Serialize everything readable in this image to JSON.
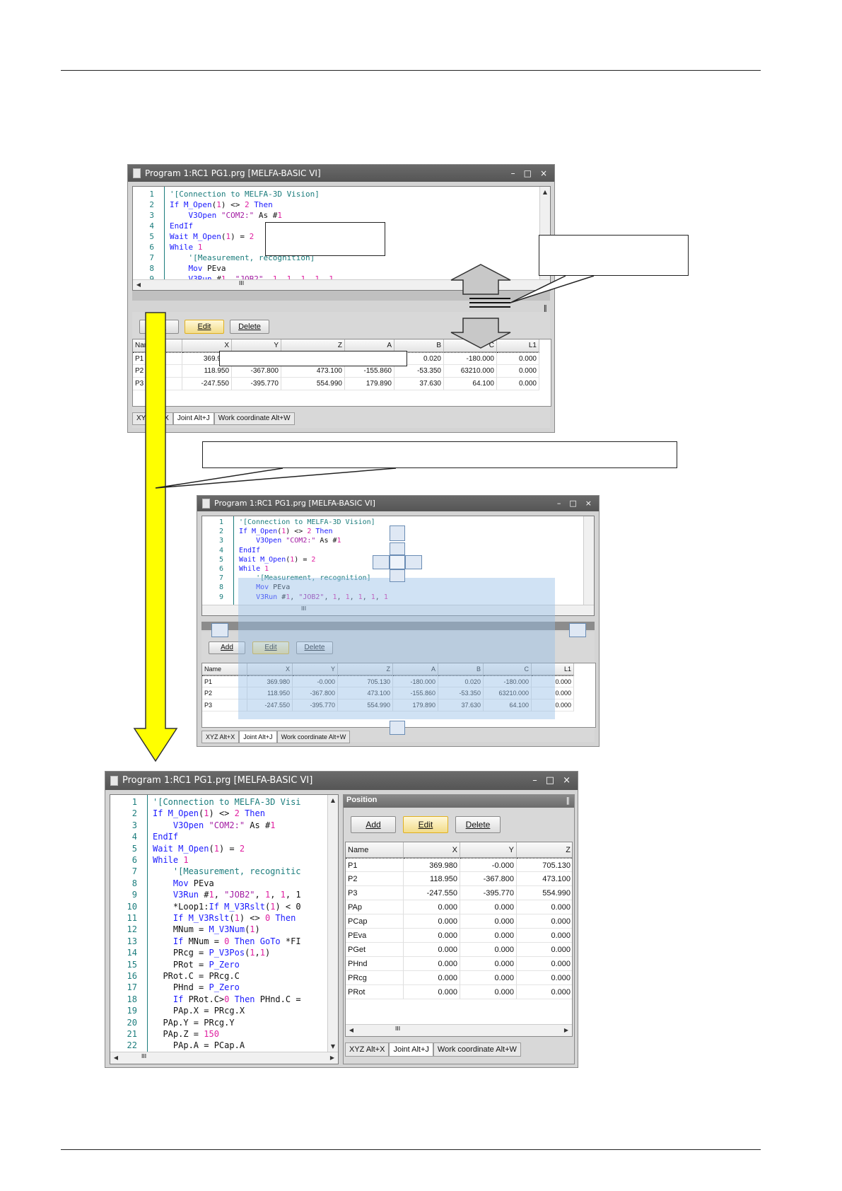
{
  "window": {
    "title": "Program 1:RC1 PG1.prg   [MELFA-BASIC VI]",
    "minimize": "–",
    "maximize": "□",
    "close": "×"
  },
  "code_lines": [
    {
      "n": "1",
      "parts": [
        [
          "cm",
          "'[Connection to MELFA-3D Vision]"
        ]
      ]
    },
    {
      "n": "2",
      "parts": [
        [
          "kw",
          "If M_Open"
        ],
        [
          "tx",
          "("
        ],
        [
          "num",
          "1"
        ],
        [
          "tx",
          ") <> "
        ],
        [
          "num",
          "2"
        ],
        [
          "kw",
          " Then"
        ]
      ]
    },
    {
      "n": "3",
      "parts": [
        [
          "tx",
          "    "
        ],
        [
          "kw",
          "V3Open "
        ],
        [
          "str",
          "\"COM2:\""
        ],
        [
          "tx",
          " As #"
        ],
        [
          "num",
          "1"
        ]
      ]
    },
    {
      "n": "4",
      "parts": [
        [
          "kw",
          "EndIf"
        ]
      ]
    },
    {
      "n": "5",
      "parts": [
        [
          "kw",
          "Wait M_Open"
        ],
        [
          "tx",
          "("
        ],
        [
          "num",
          "1"
        ],
        [
          "tx",
          ") = "
        ],
        [
          "num",
          "2"
        ]
      ]
    },
    {
      "n": "6",
      "parts": [
        [
          "kw",
          "While "
        ],
        [
          "num",
          "1"
        ]
      ]
    },
    {
      "n": "7",
      "parts": [
        [
          "cm",
          "    '[Measurement, recognition]"
        ]
      ]
    },
    {
      "n": "8",
      "parts": [
        [
          "kw",
          "    Mov "
        ],
        [
          "tx",
          "PEva"
        ]
      ]
    },
    {
      "n": "9",
      "parts": [
        [
          "kw",
          "    V3Run "
        ],
        [
          "tx",
          "#"
        ],
        [
          "num",
          "1"
        ],
        [
          "tx",
          ", "
        ],
        [
          "str",
          "\"JOB2\""
        ],
        [
          "tx",
          ", "
        ],
        [
          "num",
          "1"
        ],
        [
          "tx",
          ", "
        ],
        [
          "num",
          "1"
        ],
        [
          "tx",
          ", "
        ],
        [
          "num",
          "1"
        ],
        [
          "tx",
          ", "
        ],
        [
          "num",
          "1"
        ],
        [
          "tx",
          ", "
        ],
        [
          "num",
          "1"
        ]
      ]
    }
  ],
  "code_lines_long": [
    {
      "n": "1",
      "parts": [
        [
          "cm",
          "'[Connection to MELFA-3D Visi"
        ]
      ]
    },
    {
      "n": "2",
      "parts": [
        [
          "kw",
          "If M_Open"
        ],
        [
          "tx",
          "("
        ],
        [
          "num",
          "1"
        ],
        [
          "tx",
          ") <> "
        ],
        [
          "num",
          "2"
        ],
        [
          "kw",
          " Then"
        ]
      ]
    },
    {
      "n": "3",
      "parts": [
        [
          "tx",
          "    "
        ],
        [
          "kw",
          "V3Open "
        ],
        [
          "str",
          "\"COM2:\""
        ],
        [
          "tx",
          " As #"
        ],
        [
          "num",
          "1"
        ]
      ]
    },
    {
      "n": "4",
      "parts": [
        [
          "kw",
          "EndIf"
        ]
      ]
    },
    {
      "n": "5",
      "parts": [
        [
          "kw",
          "Wait M_Open"
        ],
        [
          "tx",
          "("
        ],
        [
          "num",
          "1"
        ],
        [
          "tx",
          ") = "
        ],
        [
          "num",
          "2"
        ]
      ]
    },
    {
      "n": "6",
      "parts": [
        [
          "kw",
          "While "
        ],
        [
          "num",
          "1"
        ]
      ]
    },
    {
      "n": "7",
      "parts": [
        [
          "cm",
          "    '[Measurement, recognitic"
        ]
      ]
    },
    {
      "n": "8",
      "parts": [
        [
          "kw",
          "    Mov "
        ],
        [
          "tx",
          "PEva"
        ]
      ]
    },
    {
      "n": "9",
      "parts": [
        [
          "kw",
          "    V3Run "
        ],
        [
          "tx",
          "#"
        ],
        [
          "num",
          "1"
        ],
        [
          "tx",
          ", "
        ],
        [
          "str",
          "\"JOB2\""
        ],
        [
          "tx",
          ", "
        ],
        [
          "num",
          "1"
        ],
        [
          "tx",
          ", "
        ],
        [
          "num",
          "1"
        ],
        [
          "tx",
          ", 1"
        ]
      ]
    },
    {
      "n": "10",
      "parts": [
        [
          "tx",
          "    *Loop1:"
        ],
        [
          "kw",
          "If M_V3Rslt"
        ],
        [
          "tx",
          "("
        ],
        [
          "num",
          "1"
        ],
        [
          "tx",
          ") < 0"
        ]
      ]
    },
    {
      "n": "11",
      "parts": [
        [
          "kw",
          "    If M_V3Rslt"
        ],
        [
          "tx",
          "("
        ],
        [
          "num",
          "1"
        ],
        [
          "tx",
          ") <> "
        ],
        [
          "num",
          "0"
        ],
        [
          "kw",
          " Then"
        ]
      ]
    },
    {
      "n": "12",
      "parts": [
        [
          "tx",
          "    MNum = "
        ],
        [
          "kw",
          "M_V3Num"
        ],
        [
          "tx",
          "("
        ],
        [
          "num",
          "1"
        ],
        [
          "tx",
          ")"
        ]
      ]
    },
    {
      "n": "13",
      "parts": [
        [
          "kw",
          "    If "
        ],
        [
          "tx",
          "MNum = "
        ],
        [
          "num",
          "0"
        ],
        [
          "kw",
          " Then GoTo "
        ],
        [
          "tx",
          "*FI"
        ]
      ]
    },
    {
      "n": "14",
      "parts": [
        [
          "tx",
          "    PRcg = "
        ],
        [
          "kw",
          "P_V3Pos"
        ],
        [
          "tx",
          "("
        ],
        [
          "num",
          "1"
        ],
        [
          "tx",
          ","
        ],
        [
          "num",
          "1"
        ],
        [
          "tx",
          ")"
        ]
      ]
    },
    {
      "n": "15",
      "parts": [
        [
          "tx",
          "    PRot = "
        ],
        [
          "kw",
          "P_Zero"
        ]
      ]
    },
    {
      "n": "16",
      "parts": [
        [
          "tx",
          "  PRot.C = PRcg.C"
        ]
      ]
    },
    {
      "n": "17",
      "parts": [
        [
          "tx",
          "    PHnd = "
        ],
        [
          "kw",
          "P_Zero"
        ]
      ]
    },
    {
      "n": "18",
      "parts": [
        [
          "kw",
          "    If "
        ],
        [
          "tx",
          "PRot.C>"
        ],
        [
          "num",
          "0"
        ],
        [
          "kw",
          " Then "
        ],
        [
          "tx",
          "PHnd.C ="
        ]
      ]
    },
    {
      "n": "19",
      "parts": [
        [
          "tx",
          "    PAp.X = PRcg.X"
        ]
      ]
    },
    {
      "n": "20",
      "parts": [
        [
          "tx",
          "  PAp.Y = PRcg.Y"
        ]
      ]
    },
    {
      "n": "21",
      "parts": [
        [
          "tx",
          "  PAp.Z = "
        ],
        [
          "num",
          "150"
        ]
      ]
    },
    {
      "n": "22",
      "parts": [
        [
          "tx",
          "    PAp.A = PCap.A"
        ]
      ]
    }
  ],
  "position_panel": {
    "title": "Position",
    "add": "Add",
    "edit": "Edit",
    "delete": "Delete",
    "columns": [
      "Name",
      "X",
      "Y",
      "Z",
      "A",
      "B",
      "C",
      "L1"
    ],
    "rows": [
      [
        "P1",
        "369.980",
        "-0.000",
        "705.130",
        "-180.000",
        "0.020",
        "-180.000",
        "0.000"
      ],
      [
        "P2",
        "118.950",
        "-367.800",
        "473.100",
        "-155.860",
        "-53.350",
        "63210.000",
        "0.000"
      ],
      [
        "P3",
        "-247.550",
        "-395.770",
        "554.990",
        "179.890",
        "37.630",
        "64.100",
        "0.000"
      ]
    ],
    "rows_full": [
      [
        "P1",
        "369.980",
        "-0.000",
        "705.130"
      ],
      [
        "P2",
        "118.950",
        "-367.800",
        "473.100"
      ],
      [
        "P3",
        "-247.550",
        "-395.770",
        "554.990"
      ],
      [
        "PAp",
        "0.000",
        "0.000",
        "0.000"
      ],
      [
        "PCap",
        "0.000",
        "0.000",
        "0.000"
      ],
      [
        "PEva",
        "0.000",
        "0.000",
        "0.000"
      ],
      [
        "PGet",
        "0.000",
        "0.000",
        "0.000"
      ],
      [
        "PHnd",
        "0.000",
        "0.000",
        "0.000"
      ],
      [
        "PRcg",
        "0.000",
        "0.000",
        "0.000"
      ],
      [
        "PRot",
        "0.000",
        "0.000",
        "0.000"
      ]
    ],
    "tabs": [
      "XYZ   Alt+X",
      "Joint   Alt+J",
      "Work coordinate   Alt+W"
    ],
    "partial_value": "369",
    "partial_tab_suffix": "+X"
  },
  "scroll_mark": "III",
  "pin_icon": "‖",
  "colors": {
    "title_bar": "#5e5e5e",
    "arrow_yellow": "#ffff00",
    "drop_overlay": "#b4d2f0",
    "line_number": "#1b7c7c"
  }
}
